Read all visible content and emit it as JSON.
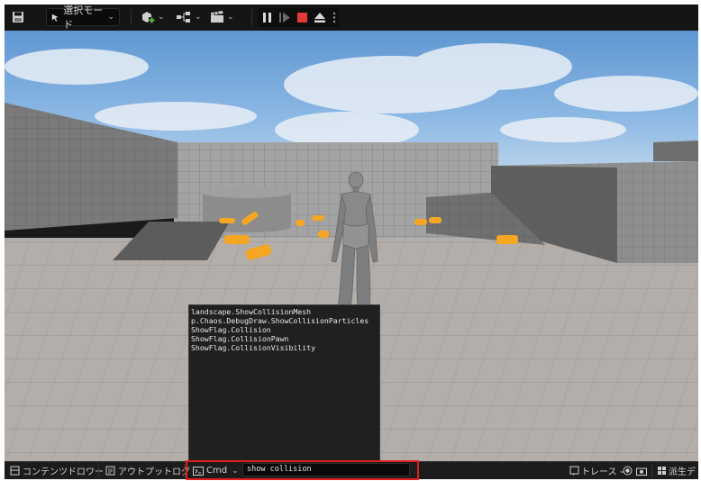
{
  "toolbar": {
    "mode_label": "選択モード",
    "icons": [
      "save-icon",
      "select-mode-icon",
      "add-actor-icon",
      "blueprint-icon",
      "cinematics-icon",
      "pause-icon",
      "skip-frame-icon",
      "stop-icon",
      "eject-icon",
      "more-options-icon"
    ]
  },
  "console": {
    "suggestions": [
      "landscape.ShowCollisionMesh",
      "p.Chaos.DebugDraw.ShowCollisionParticles",
      "ShowFlag.Collision",
      "ShowFlag.CollisionPawn",
      "ShowFlag.CollisionVisibility"
    ]
  },
  "bottombar": {
    "content_drawer": "コンテンツドロワー",
    "output_log": "アウトプットログ",
    "cmd_label": "Cmd",
    "cmd_value": "show collision",
    "trace": "トレース",
    "derived_data": "派生デ"
  },
  "colors": {
    "highlight": "#e0201c",
    "stop": "#e53935",
    "orange": "#f5a623"
  }
}
